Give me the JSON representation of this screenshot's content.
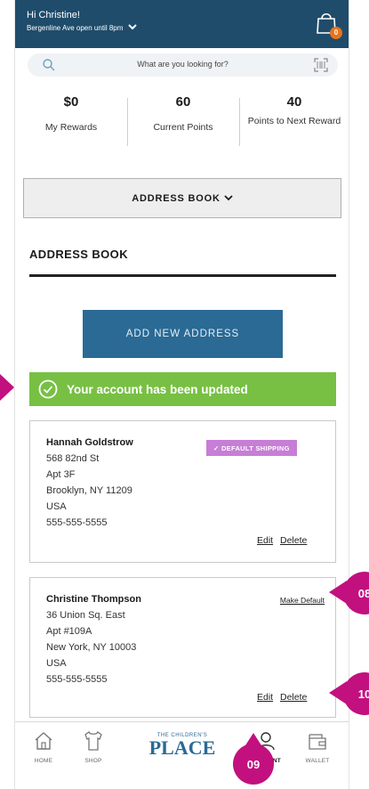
{
  "header": {
    "greeting": "Hi Christine!",
    "store_hours": "Bergenline Ave open until 8pm",
    "cart_count": "0"
  },
  "search": {
    "placeholder": "What are you looking for?"
  },
  "rewards": [
    {
      "value": "$0",
      "label": "My Rewards"
    },
    {
      "value": "60",
      "label": "Current Points"
    },
    {
      "value": "40",
      "label": "Points to Next Reward"
    }
  ],
  "address_book": {
    "dropdown_label": "ADDRESS BOOK",
    "heading": "ADDRESS BOOK",
    "add_button": "ADD NEW ADDRESS",
    "success_message": "Your account has been updated"
  },
  "addresses": [
    {
      "name": "Hannah Goldstrow",
      "line1": "568 82nd St",
      "line2": "Apt 3F",
      "city": "Brooklyn, NY 11209",
      "country": "USA",
      "phone": "555-555-5555",
      "badge": "✓ DEFAULT SHIPPING",
      "edit": "Edit",
      "delete": "Delete"
    },
    {
      "name": "Christine Thompson",
      "line1": "36 Union Sq. East",
      "line2": "Apt #109A",
      "city": "New York, NY 10003",
      "country": "USA",
      "phone": "555-555-5555",
      "make_default": "Make Default",
      "edit": "Edit",
      "delete": "Delete"
    }
  ],
  "nav": {
    "home": "HOME",
    "shop": "SHOP",
    "account": "ACCOUNT",
    "wallet": "WALLET",
    "logo_top": "THE CHILDREN'S",
    "logo_bottom": "PLACE"
  },
  "callouts": {
    "c08": "08",
    "c09": "09",
    "c10": "10"
  },
  "colors": {
    "brand": "#1f4c6b",
    "button": "#2a6a95",
    "success": "#77c043",
    "badge": "#c77ed6",
    "callout": "#c2107e",
    "cart": "#e8731b"
  }
}
